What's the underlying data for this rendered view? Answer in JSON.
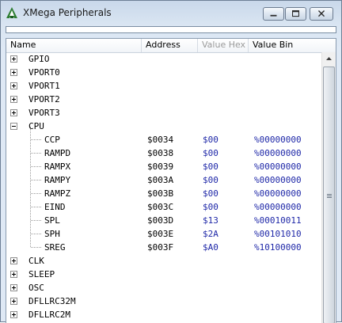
{
  "window": {
    "title": "XMega Peripherals"
  },
  "columns": {
    "name": "Name",
    "address": "Address",
    "value_hex": "Value Hex",
    "value_bin": "Value Bin"
  },
  "tree": [
    {
      "name": "GPIO",
      "expanded": false
    },
    {
      "name": "VPORT0",
      "expanded": false
    },
    {
      "name": "VPORT1",
      "expanded": false
    },
    {
      "name": "VPORT2",
      "expanded": false
    },
    {
      "name": "VPORT3",
      "expanded": false
    },
    {
      "name": "CPU",
      "expanded": true
    },
    {
      "name": "CCP",
      "address": "$0034",
      "hex": "$00",
      "bin": "%00000000"
    },
    {
      "name": "RAMPD",
      "address": "$0038",
      "hex": "$00",
      "bin": "%00000000"
    },
    {
      "name": "RAMPX",
      "address": "$0039",
      "hex": "$00",
      "bin": "%00000000"
    },
    {
      "name": "RAMPY",
      "address": "$003A",
      "hex": "$00",
      "bin": "%00000000"
    },
    {
      "name": "RAMPZ",
      "address": "$003B",
      "hex": "$00",
      "bin": "%00000000"
    },
    {
      "name": "EIND",
      "address": "$003C",
      "hex": "$00",
      "bin": "%00000000"
    },
    {
      "name": "SPL",
      "address": "$003D",
      "hex": "$13",
      "bin": "%00010011"
    },
    {
      "name": "SPH",
      "address": "$003E",
      "hex": "$2A",
      "bin": "%00101010"
    },
    {
      "name": "SREG",
      "address": "$003F",
      "hex": "$A0",
      "bin": "%10100000"
    },
    {
      "name": "CLK",
      "expanded": false
    },
    {
      "name": "SLEEP",
      "expanded": false
    },
    {
      "name": "OSC",
      "expanded": false
    },
    {
      "name": "DFLLRC32M",
      "expanded": false
    },
    {
      "name": "DFLLRC2M",
      "expanded": false
    }
  ],
  "colors": {
    "value_text": "#1f28a8",
    "dim_header": "#9a9a9a"
  }
}
